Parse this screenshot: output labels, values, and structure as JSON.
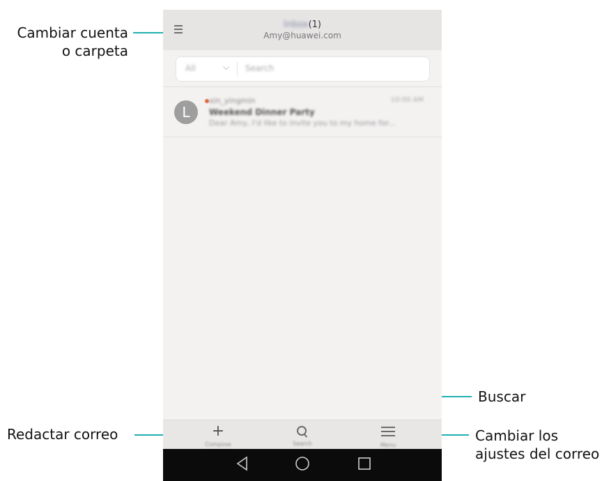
{
  "callouts": {
    "account": {
      "line1": "Cambiar cuenta",
      "line2": "o carpeta"
    },
    "compose": "Redactar correo",
    "search": "Buscar",
    "settings": {
      "line1": "Cambiar los",
      "line2": "ajustes del correo"
    }
  },
  "phone": {
    "header": {
      "folder_name": "Inbox",
      "unread_count": "(1)",
      "account_email": "Amy@huawei.com",
      "menu_icon": "menu-icon"
    },
    "search": {
      "filter_value": "All",
      "placeholder": "Search"
    },
    "messages": [
      {
        "avatar_letter": "L",
        "sender": "xin_yingmin",
        "time": "10:00 AM",
        "subject": "Weekend Dinner Party",
        "snippet": "Dear Amy,  I'd like to invite you to my home for...",
        "unread": true
      }
    ],
    "toolbar": {
      "compose_label": "Compose",
      "search_label": "Search",
      "menu_label": "Menu"
    },
    "navbar": [
      "back-icon",
      "home-icon",
      "recents-icon"
    ]
  },
  "colors": {
    "callout_line": "#20b0b0",
    "unread_dot": "#e06b43",
    "navbar": "#0b0b0b"
  }
}
